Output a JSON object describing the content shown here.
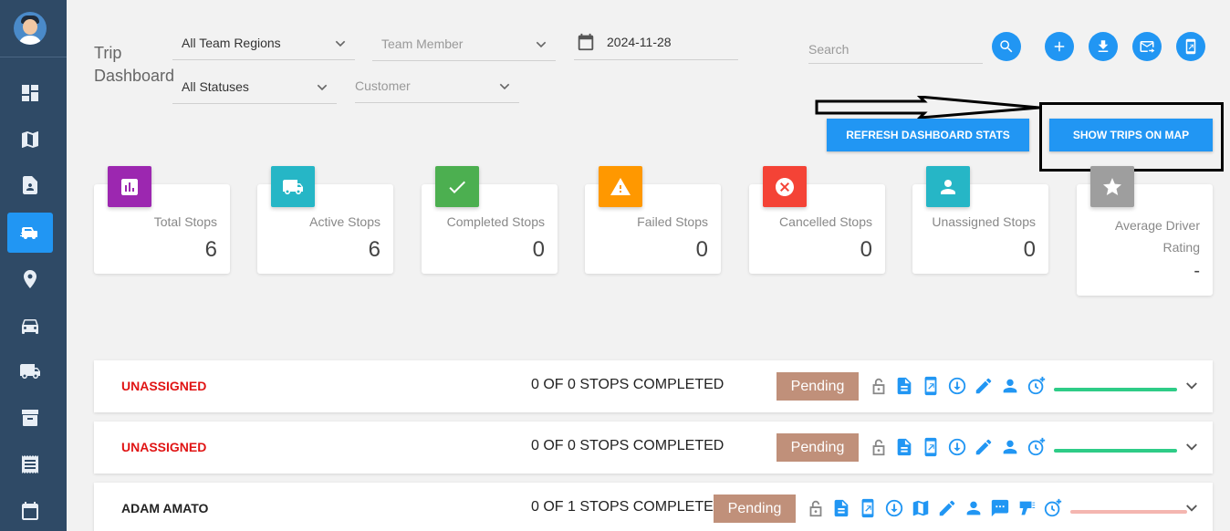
{
  "sidebar": {
    "avatar": "user-avatar",
    "items": [
      {
        "icon": "dashboard-icon",
        "active": false
      },
      {
        "icon": "map-icon",
        "active": false
      },
      {
        "icon": "contact-file-icon",
        "active": false
      },
      {
        "icon": "car-trips-icon",
        "active": true
      },
      {
        "icon": "location-pin-icon",
        "active": false
      },
      {
        "icon": "car-icon",
        "active": false
      },
      {
        "icon": "truck-icon",
        "active": false
      },
      {
        "icon": "archive-icon",
        "active": false
      },
      {
        "icon": "receipt-icon",
        "active": false
      },
      {
        "icon": "calendar-icon",
        "active": false
      }
    ]
  },
  "header": {
    "title": "Trip Dashboard",
    "filters": {
      "regions": "All Team Regions",
      "team_member": "Team Member",
      "statuses": "All Statuses",
      "customer": "Customer"
    },
    "date": "2024-11-28",
    "search_placeholder": "Search",
    "actions": [
      "search-icon",
      "add-icon",
      "download-icon",
      "email-icon",
      "mobile-icon"
    ],
    "refresh_label": "REFRESH DASHBOARD STATS",
    "show_map_label": "SHOW TRIPS ON MAP"
  },
  "stats": [
    {
      "label": "Total Stops",
      "value": "6",
      "color": "#9c27b0",
      "icon": "report-icon"
    },
    {
      "label": "Active Stops",
      "value": "6",
      "color": "#26b6c6",
      "icon": "truck-icon"
    },
    {
      "label": "Completed Stops",
      "value": "0",
      "color": "#4caf50",
      "icon": "check-icon"
    },
    {
      "label": "Failed Stops",
      "value": "0",
      "color": "#ff9800",
      "icon": "warning-icon"
    },
    {
      "label": "Cancelled Stops",
      "value": "0",
      "color": "#f44336",
      "icon": "cancel-icon"
    },
    {
      "label": "Unassigned Stops",
      "value": "0",
      "color": "#26b6c6",
      "icon": "person-icon"
    },
    {
      "label": "Average Driver Rating",
      "value": "-",
      "color": "#9e9e9e",
      "icon": "star-icon"
    }
  ],
  "trips": [
    {
      "driver": "UNASSIGNED",
      "progress_text": "0 OF 0 STOPS COMPLETED",
      "status": "Pending",
      "bar_color": "#2ecc87"
    },
    {
      "driver": "UNASSIGNED",
      "progress_text": "0 OF 0 STOPS COMPLETED",
      "status": "Pending",
      "bar_color": "#2ecc87"
    },
    {
      "driver": "ADAM AMATO",
      "progress_text": "0 OF 1 STOPS COMPLETED",
      "status": "Pending",
      "bar_color": "#f4b6b0"
    }
  ],
  "colors": {
    "accent": "#2196f3",
    "sidebar": "#2f4a66",
    "pending": "#c0907a"
  }
}
